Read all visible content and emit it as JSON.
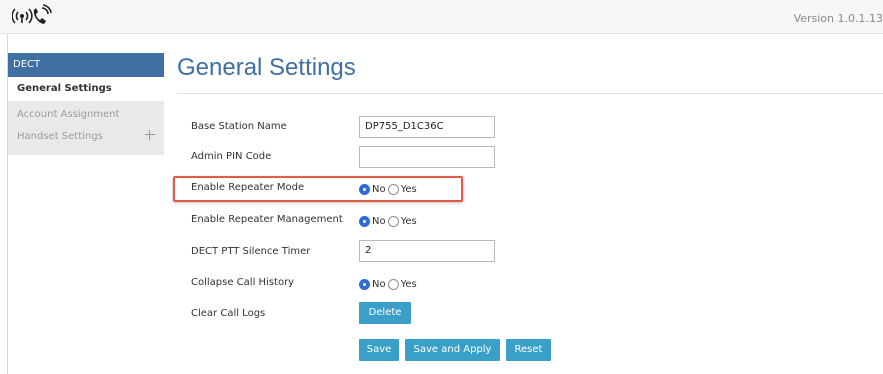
{
  "header": {
    "version_text": "Version 1.0.1.13",
    "logo_icon": "wireless-phone-icon"
  },
  "sidebar": {
    "section_title": "DECT",
    "items": [
      {
        "label": "General Settings",
        "active": true
      },
      {
        "label": "Account Assignment",
        "active": false
      },
      {
        "label": "Handset Settings",
        "active": false,
        "icon": "plus-icon"
      }
    ]
  },
  "main": {
    "page_title": "General Settings",
    "fields": {
      "base_station_name": {
        "label": "Base Station Name",
        "value": "DP755_D1C36C"
      },
      "admin_pin_code": {
        "label": "Admin PIN Code",
        "value": ""
      },
      "enable_repeater_mode": {
        "label": "Enable Repeater Mode",
        "options": [
          "No",
          "Yes"
        ],
        "selected": "No"
      },
      "enable_repeater_management": {
        "label": "Enable Repeater Management",
        "options": [
          "No",
          "Yes"
        ],
        "selected": "No"
      },
      "dect_ptt_silence_timer": {
        "label": "DECT PTT Silence Timer",
        "value": "2"
      },
      "collapse_call_history": {
        "label": "Collapse Call History",
        "options": [
          "No",
          "Yes"
        ],
        "selected": "No"
      },
      "clear_call_logs": {
        "label": "Clear Call Logs",
        "button": "Delete"
      }
    },
    "actions": {
      "save": "Save",
      "save_and_apply": "Save and Apply",
      "reset": "Reset"
    }
  },
  "colors": {
    "accent": "#3f6fa3",
    "button": "#3aa0c8",
    "highlight": "#e05a4c"
  }
}
